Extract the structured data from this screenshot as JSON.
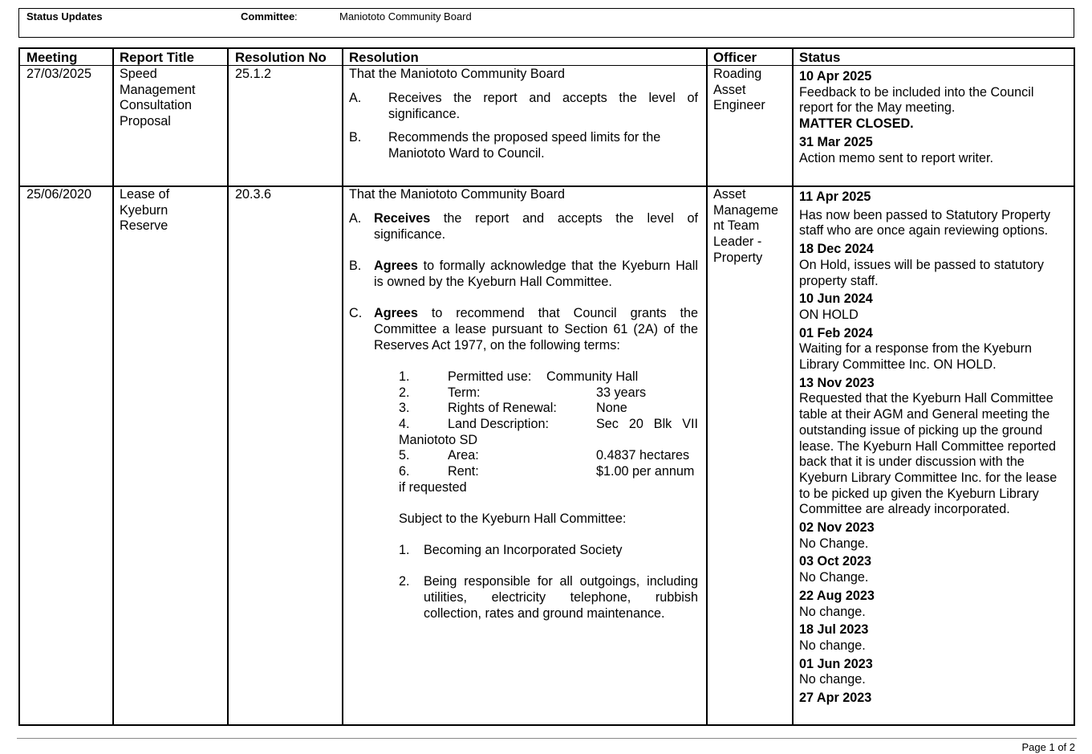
{
  "header": {
    "status_label": "Status Updates",
    "committee_label": "Committee",
    "committee_colon": ":",
    "committee_value": "Maniototo Community Board"
  },
  "table": {
    "columns": [
      "Meeting",
      "Report Title",
      "Resolution No",
      "Resolution",
      "Officer",
      "Status"
    ],
    "rows": [
      {
        "meeting": "27/03/2025",
        "report_title": [
          "Speed",
          "Management",
          "Consultation",
          "Proposal"
        ],
        "resolution_no": "25.1.2",
        "resolution": {
          "intro": "That the Maniototo Community Board",
          "items": [
            {
              "letter": "A.",
              "lines": [
                "Receives the report and accepts the level of",
                "significance."
              ]
            },
            {
              "letter": "B.",
              "lines": [
                "Recommends the proposed speed limits for the",
                "Maniototo Ward to Council."
              ]
            }
          ]
        },
        "officer": [
          "Roading",
          "Asset",
          "Engineer"
        ],
        "status": [
          {
            "date": "10 Apr 2025",
            "text": "Feedback to be included into the Council report for the May meeting.",
            "extra": "MATTER CLOSED."
          },
          {
            "date": "31 Mar 2025",
            "text": "Action memo sent to report writer.",
            "extra": ""
          }
        ]
      },
      {
        "meeting": "25/06/2020",
        "report_title": [
          "Lease of",
          "Kyeburn",
          "Reserve"
        ],
        "resolution_no": "20.3.6",
        "resolution": {
          "intro": "That the Maniototo Community Board",
          "item_a": {
            "letter": "A.",
            "bold": "Receives",
            "line1": "the report and accepts the level of",
            "line2": "significance."
          },
          "item_b": {
            "letter": "B.",
            "bold": "Agrees",
            "line1": "to formally acknowledge that the Kyeburn Hall",
            "line2": "is owned by the Kyeburn Hall Committee."
          },
          "item_c": {
            "letter": "C.",
            "bold": "Agrees",
            "line1": "to recommend that Council grants the",
            "line2": "Committee a lease pursuant to Section 61 (2A) of the",
            "line3": "Reserves Act 1977, on the following terms:"
          },
          "terms": [
            {
              "num": "1.",
              "label": "Permitted use:",
              "value": "Community Hall",
              "cont": ""
            },
            {
              "num": "2.",
              "label": "Term:",
              "value": "33 years",
              "cont": ""
            },
            {
              "num": "3.",
              "label": "Rights of Renewal:",
              "value": "None",
              "cont": ""
            },
            {
              "num": "4.",
              "label": "Land Description:",
              "value": "Sec 20 Blk VII",
              "cont": "Maniototo SD"
            },
            {
              "num": "5.",
              "label": "Area:",
              "value": "0.4837 hectares",
              "cont": ""
            },
            {
              "num": "6.",
              "label": "Rent:",
              "value": "$1.00 per annum",
              "cont": "if requested"
            }
          ],
          "subject": "Subject to the Kyeburn Hall Committee:",
          "conditions": [
            {
              "num": "1.",
              "lines": [
                "Becoming an Incorporated Society"
              ]
            },
            {
              "num": "2.",
              "lines": [
                "Being responsible for all outgoings, including",
                "utilities, electricity telephone, rubbish",
                "collection, rates and ground maintenance."
              ]
            }
          ]
        },
        "officer": [
          "Asset",
          "Manageme",
          "nt Team",
          "Leader -",
          "Property"
        ],
        "status": [
          {
            "date": "11 Apr 2025",
            "text": "Has now been passed to Statutory Property staff who are once again reviewing options."
          },
          {
            "date": "18 Dec 2024",
            "text": "On Hold, issues will be passed to statutory property staff."
          },
          {
            "date": "10 Jun 2024",
            "text": "ON HOLD"
          },
          {
            "date": "01 Feb 2024",
            "text": "Waiting for a response from the Kyeburn Library Committee Inc. ON HOLD."
          },
          {
            "date": "13 Nov 2023",
            "text": "Requested that the Kyeburn Hall Committee table at their AGM and General meeting the outstanding issue of picking up the ground lease.  The Kyeburn Hall Committee reported back that it is under discussion with the Kyeburn Library Committee Inc. for the lease to be picked up given the Kyeburn Library Committee are already incorporated."
          },
          {
            "date": "02 Nov 2023",
            "text": "No Change."
          },
          {
            "date": "03 Oct 2023",
            "text": "No Change."
          },
          {
            "date": "22 Aug 2023",
            "text": "No change."
          },
          {
            "date": "18 Jul 2023",
            "text": "No change."
          },
          {
            "date": "01 Jun 2023",
            "text": "No change."
          },
          {
            "date": "27 Apr 2023",
            "text": ""
          }
        ]
      }
    ]
  },
  "footer": {
    "page": "Page 1 of 2"
  }
}
